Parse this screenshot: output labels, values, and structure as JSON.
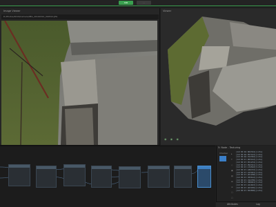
{
  "toolbar": {
    "sfm_label": "SfM",
    "other_tab_label": "..."
  },
  "image_viewer": {
    "title": "Image Viewer",
    "path": "D:/Photos/2019/Camera/IMG_20190314_094521.JPG",
    "footer": {
      "exposure": "+ 1.0",
      "gamma": "1.00",
      "resolution": "4608x3456",
      "other": "Image"
    }
  },
  "viewer3d": {
    "title": "Viewer",
    "footer_icons": "◉ ◉ ◉"
  },
  "side_panel": {
    "title": "5: Node - Texturing",
    "checker_label": "Checker",
    "icons": [
      "▸",
      "T",
      "◇",
      "▣",
      "▤",
      "⊞",
      "≡",
      "☐",
      "☐"
    ],
    "log_lines": [
      "[14:38:46.802324][info]",
      "[14:38:46.857413][info]",
      "[14:38:46.912302][info]",
      "[14:38:47.003412][info]",
      "[14:38:47.051234][info]",
      "[14:38:47.092341][info]",
      "[14:38:47.134502][info]",
      "[14:38:47.186743][info]",
      "[14:38:47.223401][info]",
      "[14:38:47.261298][info]",
      "[14:38:47.305612][info]",
      "[14:38:47.342789][info]",
      "[14:38:47.388901][info]",
      "[14:38:47.421023][info]",
      "[14:38:47.463456][info]",
      "[14:38:47.502890][info]"
    ],
    "tabs": [
      "Attributes",
      "Log"
    ]
  },
  "colors": {
    "accent_green": "#3aa04f",
    "selected_blue": "#3b7fc8"
  }
}
